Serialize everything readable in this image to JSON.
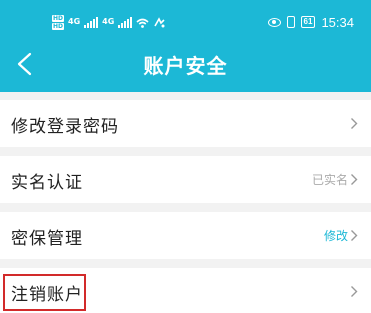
{
  "status_bar": {
    "hd_top": "HD",
    "hd_bottom": "HD",
    "network_1": "4G",
    "network_2": "4G",
    "battery": "61",
    "time": "15:34"
  },
  "header": {
    "title": "账户安全",
    "back_icon": "chevron-left-icon"
  },
  "menu": {
    "items": [
      {
        "label": "修改登录密码",
        "value": "",
        "value_color": "#999999"
      },
      {
        "label": "实名认证",
        "value": "已实名",
        "value_color": "#aaaaaa"
      },
      {
        "label": "密保管理",
        "value": "修改",
        "value_color": "#1cb8d6"
      },
      {
        "label": "注销账户",
        "value": "",
        "value_color": "#999999"
      }
    ]
  },
  "colors": {
    "header": "#1cb8d6",
    "background": "#f2f2f2",
    "highlight_border": "#d22a2a"
  }
}
